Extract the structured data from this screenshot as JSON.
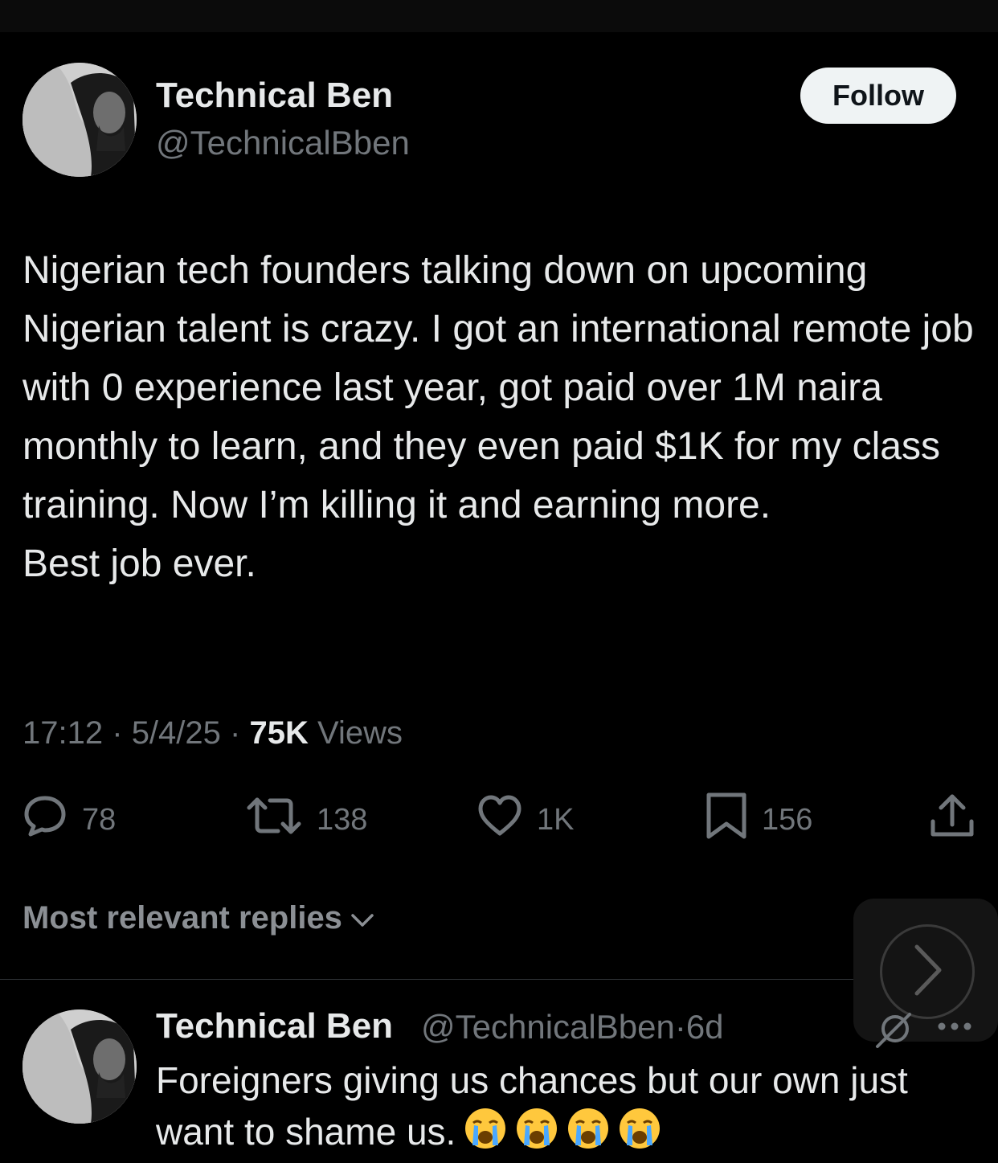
{
  "tweet": {
    "author_name": "Technical Ben",
    "author_handle": "@TechnicalBben",
    "follow_label": "Follow",
    "text_lines": [
      "Nigerian tech founders talking down on upcoming Nigerian talent is crazy. I got an international remote job with 0 experience last year, got paid over 1M naira monthly to learn, and they even paid $1K for my class training. Now I’m killing it and earning more.",
      "Best job ever."
    ],
    "time": "17:12",
    "date": "5/4/25",
    "views_count": "75K",
    "views_label": "Views",
    "separator": "·",
    "replies_count": "78",
    "reposts_count": "138",
    "likes_count": "1K",
    "bookmarks_count": "156"
  },
  "replies_section": {
    "sort_label": "Most relevant replies"
  },
  "reply": {
    "author_name": "Technical Ben",
    "author_handle": "@TechnicalBben",
    "age": "6d",
    "separator": "·",
    "text": "Foreigners giving us chances but our own just want to shame us.",
    "emoji": [
      "loudly-crying-face",
      "loudly-crying-face",
      "loudly-crying-face",
      "loudly-crying-face"
    ]
  },
  "colors": {
    "background": "#000000",
    "text": "#e7e9ea",
    "secondary": "#71767b",
    "follow_button_bg": "#eff3f4"
  }
}
